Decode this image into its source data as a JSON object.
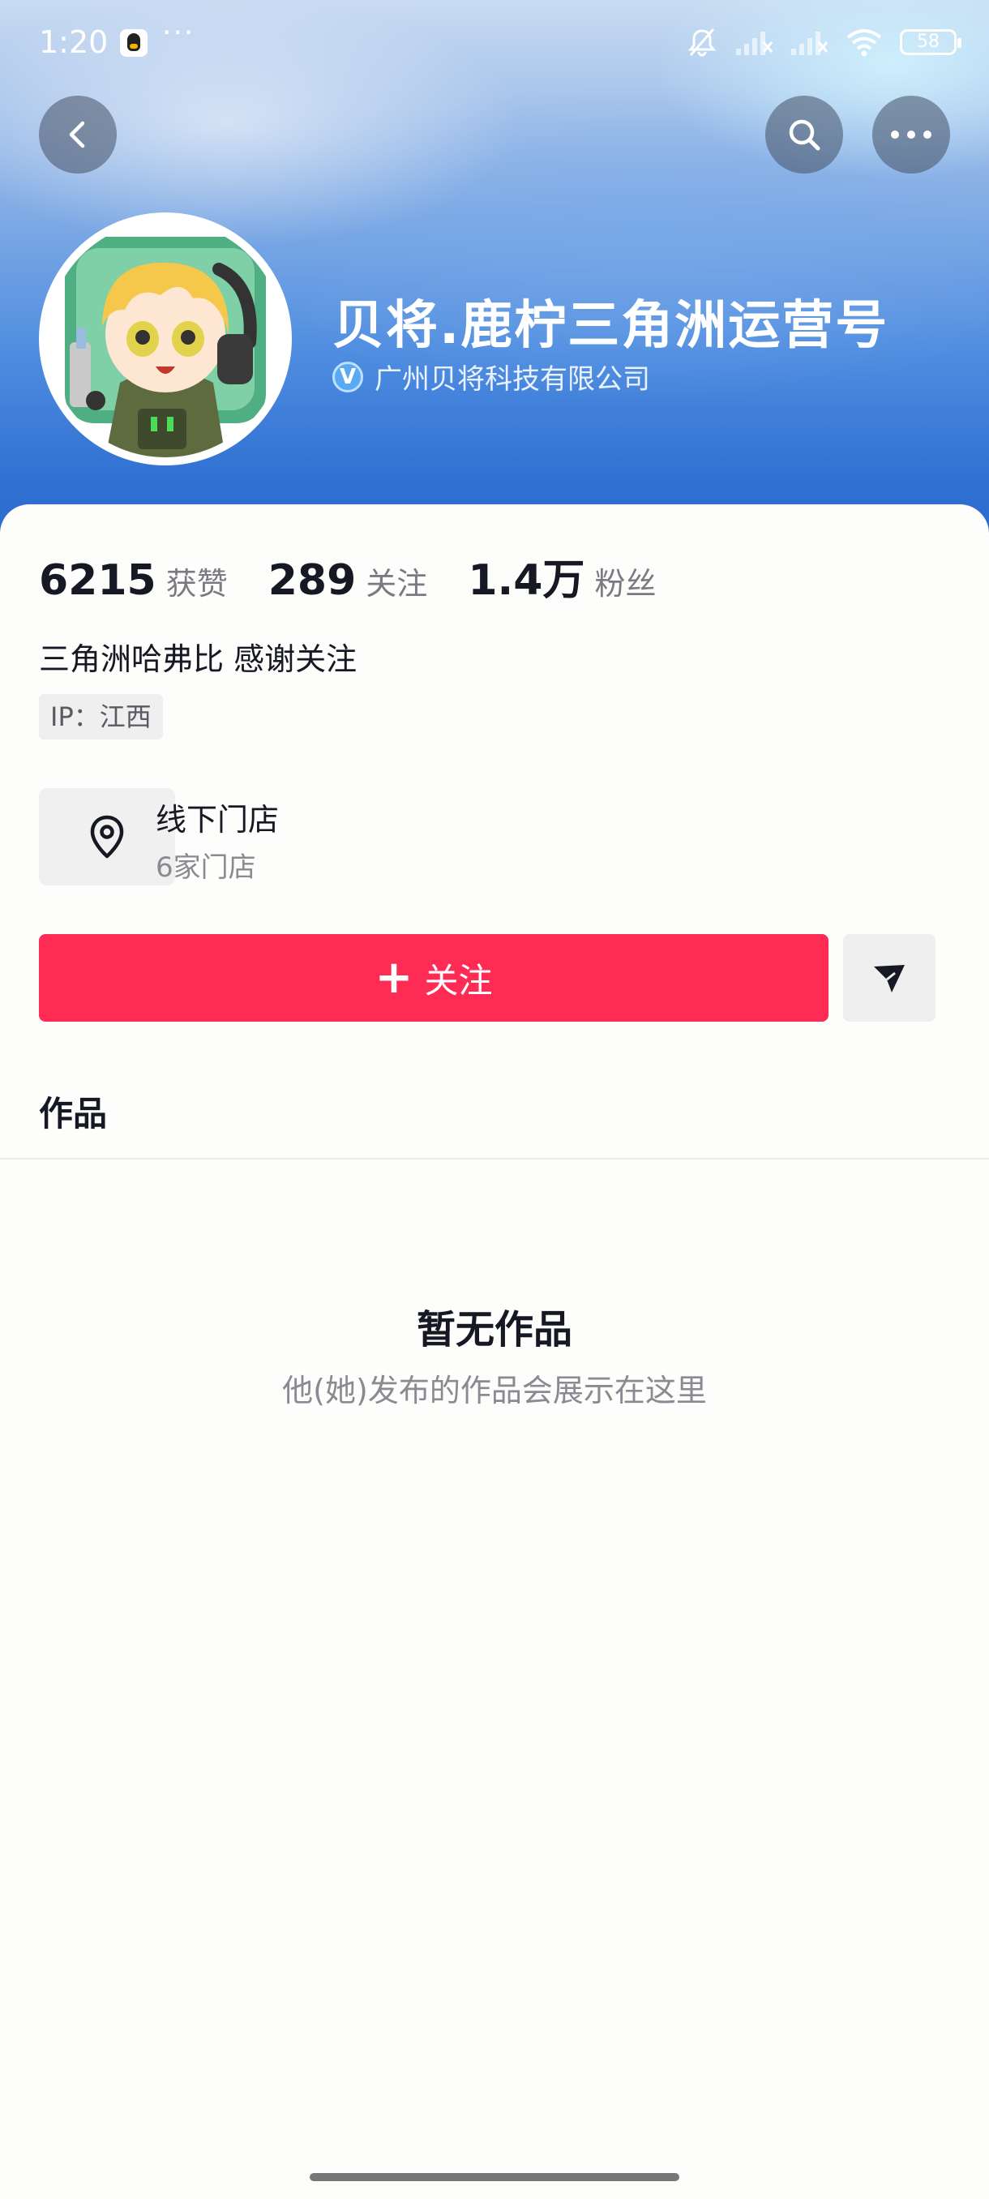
{
  "status_bar": {
    "time": "1:20",
    "overflow": "···",
    "battery": "58"
  },
  "icons": {
    "back": "chevron-left-icon",
    "search": "search-icon",
    "more": "more-dots-icon",
    "location": "location-pin-icon",
    "share": "share-send-icon"
  },
  "profile": {
    "name": "贝将.鹿柠三角洲运营号",
    "verified_company": "广州贝将科技有限公司",
    "verify_badge": "V"
  },
  "stats": [
    {
      "value": "6215",
      "label": "获赞"
    },
    {
      "value": "289",
      "label": "关注"
    },
    {
      "value": "1.4万",
      "label": "粉丝"
    }
  ],
  "bio": "三角洲哈弗比 感谢关注",
  "ip_tag": "IP：江西",
  "store": {
    "title": "线下门店",
    "subtitle": "6家门店"
  },
  "actions": {
    "follow_plus": "+",
    "follow_label": "关注"
  },
  "tabs": {
    "works": "作品"
  },
  "empty_state": {
    "title": "暂无作品",
    "subtitle": "他(她)发布的作品会展示在这里"
  },
  "colors": {
    "accent": "#fe2c55",
    "header_blue": "#2f70d2",
    "verify_blue": "#5aa9f5"
  }
}
